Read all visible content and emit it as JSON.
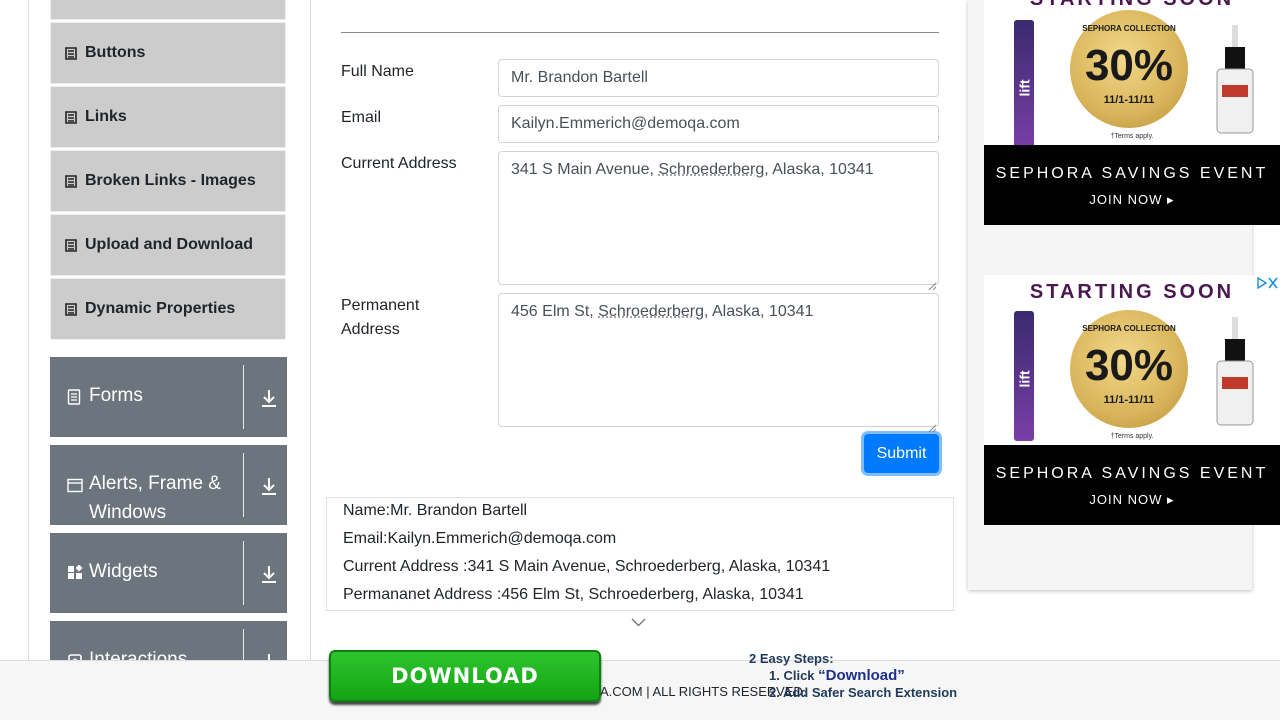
{
  "sidebar": {
    "items": [
      {
        "label": "Buttons"
      },
      {
        "label": "Links"
      },
      {
        "label": "Broken Links - Images"
      },
      {
        "label": "Upload and Download"
      },
      {
        "label": "Dynamic Properties"
      }
    ],
    "groups": [
      {
        "label": "Forms",
        "icon": "form-icon"
      },
      {
        "label": "Alerts, Frame &",
        "label2": "Windows",
        "icon": "window-icon"
      },
      {
        "label": "Widgets",
        "icon": "widgets-icon"
      },
      {
        "label": "Interactions",
        "icon": "interactions-icon"
      }
    ]
  },
  "form": {
    "full_name_label": "Full Name",
    "full_name_value": "Mr. Brandon Bartell",
    "email_label": "Email",
    "email_value": "Kailyn.Emmerich@demoqa.com",
    "current_address_label": "Current Address",
    "current_address_pre": "341 S Main Avenue, ",
    "current_address_city": "Schroederberg",
    "current_address_post": ", Alaska, 10341",
    "permanent_address_label1": "Permanent",
    "permanent_address_label2": "Address",
    "permanent_address_pre": "456 Elm St, ",
    "permanent_address_city": "Schroederberg",
    "permanent_address_post": ", Alaska, 10341",
    "submit_label": "Submit"
  },
  "output": {
    "name": "Name:Mr. Brandon Bartell",
    "email": "Email:Kailyn.Emmerich@demoqa.com",
    "current": "Current Address :341 S Main Avenue, Schroederberg, Alaska, 10341",
    "permanent": "Permananet Address :456 Elm St, Schroederberg, Alaska, 10341"
  },
  "ads": {
    "top_head": "STARTING SOON",
    "head": "STARTING SOON",
    "collection": "SEPHORA COLLECTION",
    "percent": "30%",
    "off": "OFF",
    "dates": "11/1-11/11",
    "terms": "†Terms apply.",
    "event": "SEPHORA SAVINGS EVENT",
    "join": "JOIN NOW ▸",
    "mascara_text": "lift",
    "brand_color": "#4a1750"
  },
  "footer": {
    "copyright": "A.COM | ALL RIGHTS RESERVED."
  },
  "download_ad": {
    "button": "DOWNLOAD",
    "title": "2 Easy Steps:",
    "step1_prefix": "1. Click ",
    "step1_emph": "“Download”",
    "step2": "2. Add Safer Search Extension"
  },
  "colors": {
    "primary": "#007bff",
    "sidebar_group": "#6c757d",
    "sidebar_item": "#cccccc",
    "download_green": "#14a314"
  }
}
